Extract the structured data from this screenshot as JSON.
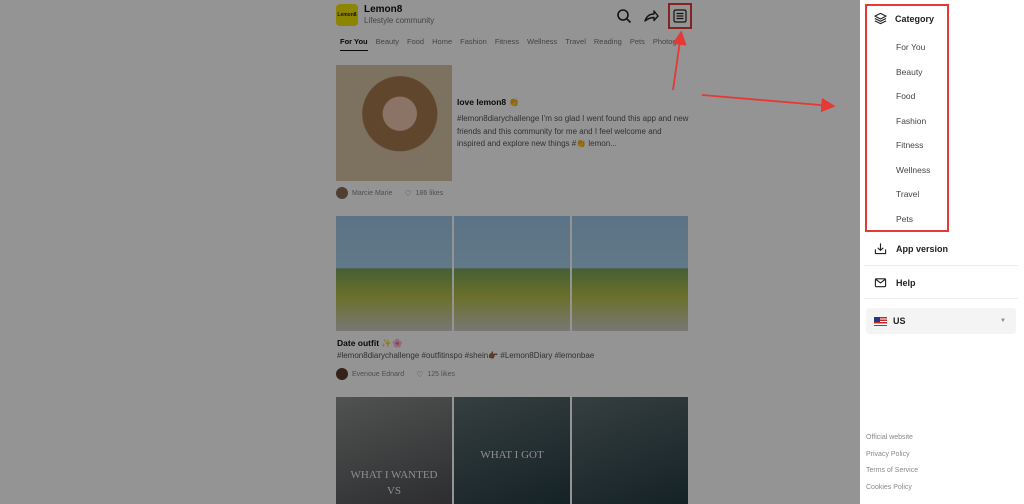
{
  "header": {
    "brand": "Lemon8",
    "tagline": "Lifestyle community",
    "logo_text": "Lemon8"
  },
  "tabs": [
    "For You",
    "Beauty",
    "Food",
    "Home",
    "Fashion",
    "Fitness",
    "Wellness",
    "Travel",
    "Reading",
    "Pets",
    "Photogra"
  ],
  "posts": [
    {
      "title": "love lemon8 👏",
      "body": "#lemon8diarychallenge I'm so glad I went found this app and new friends and this community for me and I feel welcome and inspired and explore new things #👏 lemon...",
      "author": "Marcie Marie",
      "likes": "186 likes"
    },
    {
      "title": "Date outfit ✨🌸",
      "body": "#lemon8diarychallenge #outfitinspo #shein👉🏾 #Lemon8Diary #lemonbae",
      "author": "Evenoue Ednard",
      "likes": "125 likes"
    },
    {
      "captions": [
        "WHAT I WANTED",
        "VS",
        "WHAT I GOT"
      ]
    }
  ],
  "drawer": {
    "category_label": "Category",
    "categories": [
      "For You",
      "Beauty",
      "Food",
      "Fashion",
      "Fitness",
      "Wellness",
      "Travel",
      "Pets"
    ],
    "app_version": "App version",
    "help": "Help",
    "language": "US",
    "footer_links": [
      "Official website",
      "Privacy Policy",
      "Terms of Service",
      "Cookies Policy"
    ]
  },
  "colors": {
    "highlight": "#e53935",
    "overlay": "rgba(0,0,0,0.42)",
    "logo": "#f3e600"
  }
}
